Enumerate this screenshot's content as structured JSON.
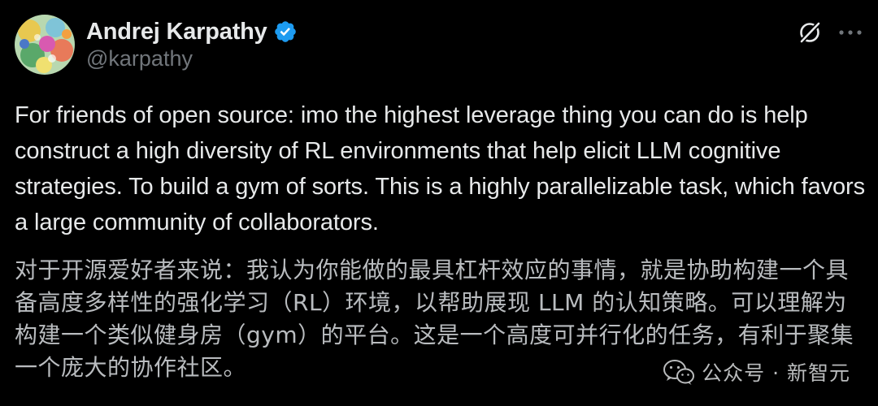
{
  "author": {
    "display_name": "Andrej Karpathy",
    "handle": "@karpathy",
    "verified": true,
    "verified_color": "#1d9bf0"
  },
  "header_actions": {
    "grok_icon": "grok-icon",
    "more_icon": "more-dots-icon"
  },
  "tweet": {
    "text_en": "For friends of open source: imo the highest leverage thing you can do is help construct a high diversity of RL environments that help elicit LLM cognitive strategies. To build a gym of sorts. This is a highly parallelizable task, which favors a large community of collaborators.",
    "text_zh": "对于开源爱好者来说：我认为你能做的最具杠杆效应的事情，就是协助构建一个具备高度多样性的强化学习（RL）环境，以帮助展现 LLM 的认知策略。可以理解为构建一个类似健身房（gym）的平台。这是一个高度可并行化的任务，有利于聚集一个庞大的协作社区。"
  },
  "watermark": {
    "icon": "wechat-icon",
    "text": "公众号 · 新智元"
  },
  "colors": {
    "background": "#000000",
    "primary_text": "#e7e9ea",
    "secondary_text": "#71767b"
  }
}
